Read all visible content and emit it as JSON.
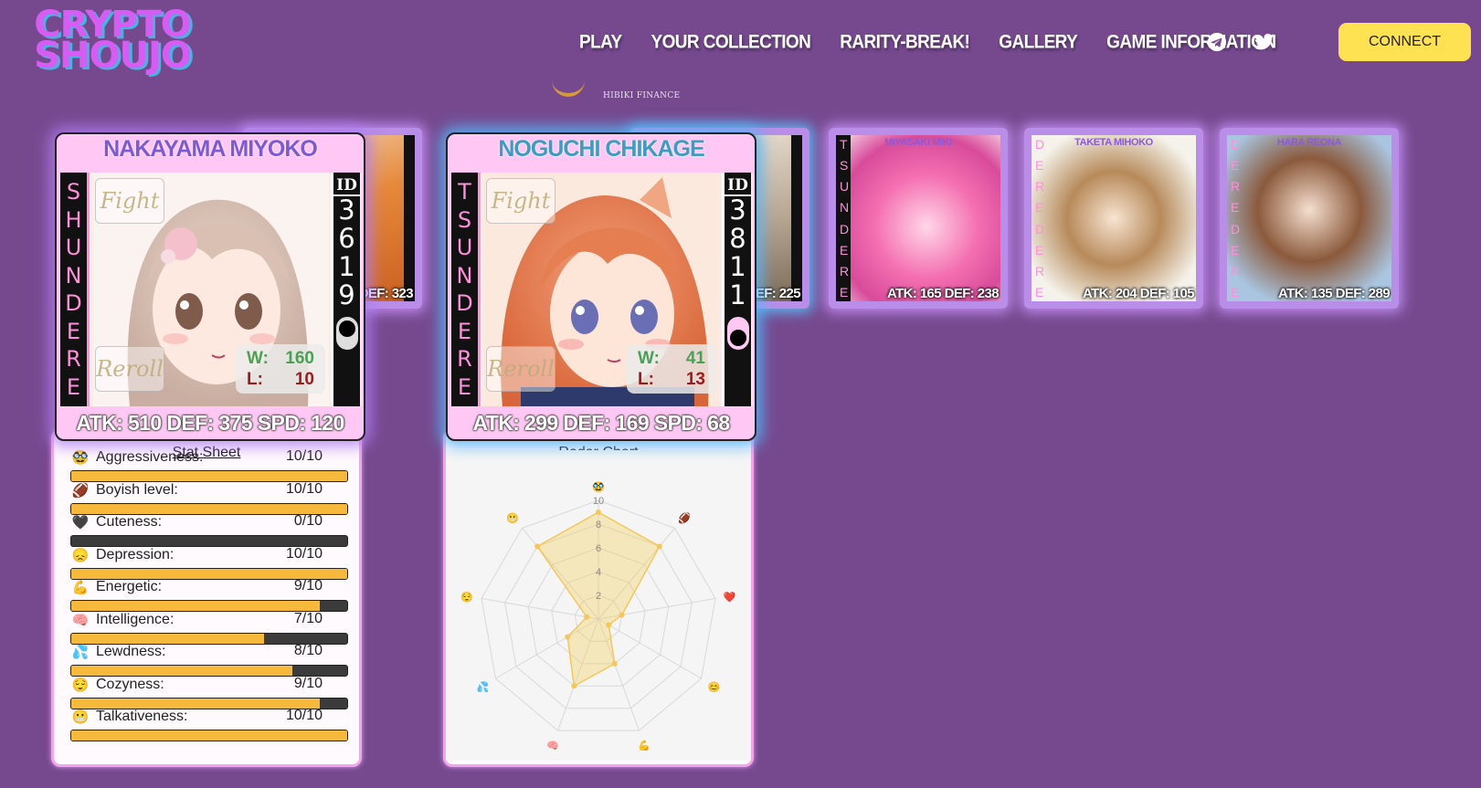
{
  "logo": {
    "line1": "CRYPTO",
    "line2": "SHOUJO"
  },
  "nav": [
    "PLAY",
    "YOUR COLLECTION",
    "RARITY-BREAK!",
    "GALLERY",
    "GAME INFORMATION"
  ],
  "social": {
    "telegram": "telegram-icon",
    "twitter": "twitter-icon"
  },
  "connect_label": "CONNECT",
  "sponsor": "HIBIKI FINANCE",
  "colors": {
    "background": "#76498f",
    "connect": "#ffe252",
    "card": "#ffc8f4",
    "bar_fill": "#f6b93b",
    "bar_empty": "#3b3b3b"
  },
  "thumbs": [
    {
      "name": "",
      "type": "",
      "stats": "DEF: 323"
    },
    {
      "name": "",
      "type": "",
      "stats": "DEF: 225"
    },
    {
      "name": "MIYASAKI MIKI",
      "type": "TSUNDERE",
      "stats": "ATK: 165 DEF: 238"
    },
    {
      "name": "TAKETA MIHOKO",
      "type": "DEREDERE",
      "stats": "ATK: 204 DEF: 105"
    },
    {
      "name": "HARA REONA",
      "type": "DEREDERE",
      "stats": "ATK: 135 DEF: 289"
    }
  ],
  "card1": {
    "name": "NAKAYAMA MIYOKO",
    "type": "SHUNDERE",
    "id_label": "ID",
    "id": "3619",
    "fight": "Fight",
    "reroll": "Reroll",
    "w_label": "W:",
    "w": "160",
    "l_label": "L:",
    "l": "10",
    "stats": "ATK: 510 DEF: 375 SPD: 120"
  },
  "card2": {
    "name": "NOGUCHI CHIKAGE",
    "type": "TSUNDERE",
    "id_label": "ID",
    "id": "3811",
    "fight": "Fight",
    "reroll": "Reroll",
    "w_label": "W:",
    "w": "41",
    "l_label": "L:",
    "l": "13",
    "stats": "ATK: 299 DEF: 169 SPD: 68"
  },
  "stat_sheet": {
    "title": "Stat Sheet",
    "rows": [
      {
        "icon": "🥸",
        "label": "Aggressiveness:",
        "value": "10/10",
        "fill": 1.0
      },
      {
        "icon": "🏈",
        "label": "Boyish level:",
        "value": "10/10",
        "fill": 1.0
      },
      {
        "icon": "🖤",
        "label": "Cuteness:",
        "value": "0/10",
        "fill": 0.0
      },
      {
        "icon": "😞",
        "label": "Depression:",
        "value": "10/10",
        "fill": 1.0
      },
      {
        "icon": "💪",
        "label": "Energetic:",
        "value": "9/10",
        "fill": 0.9
      },
      {
        "icon": "🧠",
        "label": "Intelligence:",
        "value": "7/10",
        "fill": 0.7
      },
      {
        "icon": "💦",
        "label": "Lewdness:",
        "value": "8/10",
        "fill": 0.8
      },
      {
        "icon": "😌",
        "label": "Cozyness:",
        "value": "9/10",
        "fill": 0.9
      },
      {
        "icon": "😬",
        "label": "Talkativeness:",
        "value": "10/10",
        "fill": 1.0
      }
    ]
  },
  "radar": {
    "title": "Radar Chart",
    "axis_icons": [
      "🥸",
      "🏈",
      "❤️",
      "😊",
      "💪",
      "🧠",
      "💦",
      "😌",
      "😬"
    ],
    "ticks": [
      "2",
      "4",
      "6",
      "8",
      "10"
    ]
  },
  "chart_data": {
    "type": "radar",
    "title": "Radar Chart",
    "categories": [
      "🥸",
      "🏈",
      "❤️",
      "😊",
      "💪",
      "🧠",
      "💦",
      "😌",
      "😬"
    ],
    "values": [
      9,
      8,
      2,
      1,
      4,
      6,
      3,
      1,
      8
    ],
    "ylim": [
      0,
      10
    ],
    "ticks": [
      2,
      4,
      6,
      8,
      10
    ],
    "grid": true
  }
}
